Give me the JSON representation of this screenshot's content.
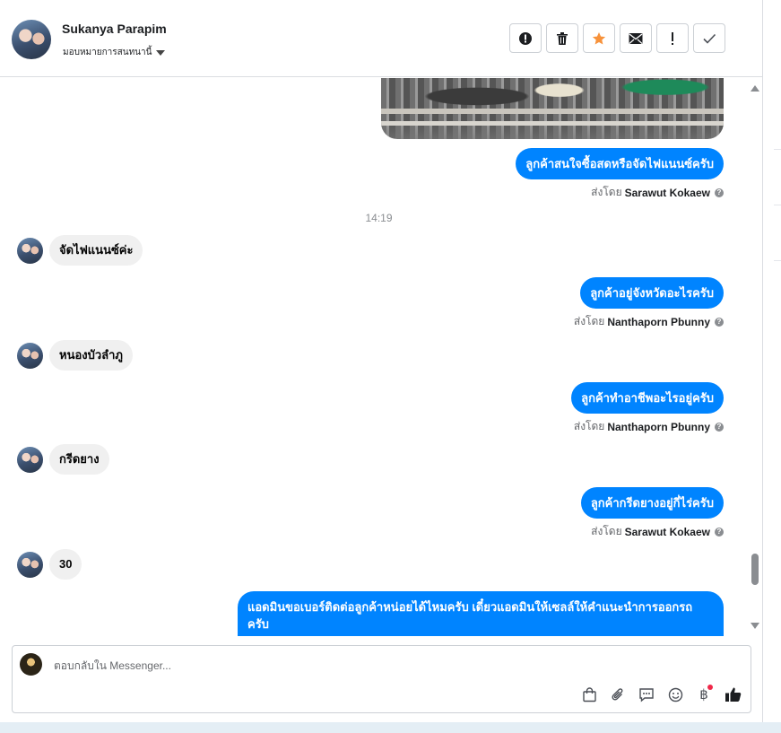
{
  "header": {
    "contact_name": "Sukanya Parapim",
    "assign_label": "มอบหมายการสนทนานี้",
    "actions": [
      {
        "name": "spam-button",
        "icon": "alert-circle-icon"
      },
      {
        "name": "delete-button",
        "icon": "trash-icon"
      },
      {
        "name": "star-button",
        "icon": "star-icon"
      },
      {
        "name": "mark-unread-button",
        "icon": "envelope-icon"
      },
      {
        "name": "important-button",
        "icon": "exclamation-icon"
      },
      {
        "name": "done-button",
        "icon": "check-icon"
      }
    ],
    "star_color": "#f7923b"
  },
  "messages": {
    "photo_icon": "engine-photo",
    "m1": {
      "text": "ลูกค้าสนใจซื้อสดหรือจัดไฟแนนซ์ครับ",
      "sent_by_label": "ส่งโดย",
      "sender": "Sarawut Kokaew"
    },
    "time": "14:19",
    "in1": "จัดไฟแนนซ์ค่ะ",
    "m2": {
      "text": "ลูกค้าอยู่จังหวัดอะไรครับ",
      "sent_by_label": "ส่งโดย",
      "sender": "Nanthaporn Pbunny"
    },
    "in2": "หนองบัวลำภู",
    "m3": {
      "text": "ลูกค้าทำอาชีพอะไรอยู่ครับ",
      "sent_by_label": "ส่งโดย",
      "sender": "Nanthaporn Pbunny"
    },
    "in3": "กรีดยาง",
    "m4": {
      "text": "ลูกค้ากรีดยางอยู่กี่ไร่ครับ",
      "sent_by_label": "ส่งโดย",
      "sender": "Sarawut Kokaew"
    },
    "in4": "30",
    "m5": {
      "line1": "แอดมินขอเบอร์ติดต่อลูกค้าหน่อยได้ไหมครับ เดี๋ยวแอดมินให้เซลล์ให้คำแนะนำการออกรถ",
      "line2": "ครับ"
    },
    "outgoing_color": "#0084ff"
  },
  "composer": {
    "placeholder": "ตอบกลับใน Messenger...",
    "tools": [
      "shop-bag-icon",
      "attachment-icon",
      "saved-reply-icon",
      "emoji-icon",
      "baht-icon",
      "like-icon"
    ],
    "baht_symbol": "฿"
  }
}
